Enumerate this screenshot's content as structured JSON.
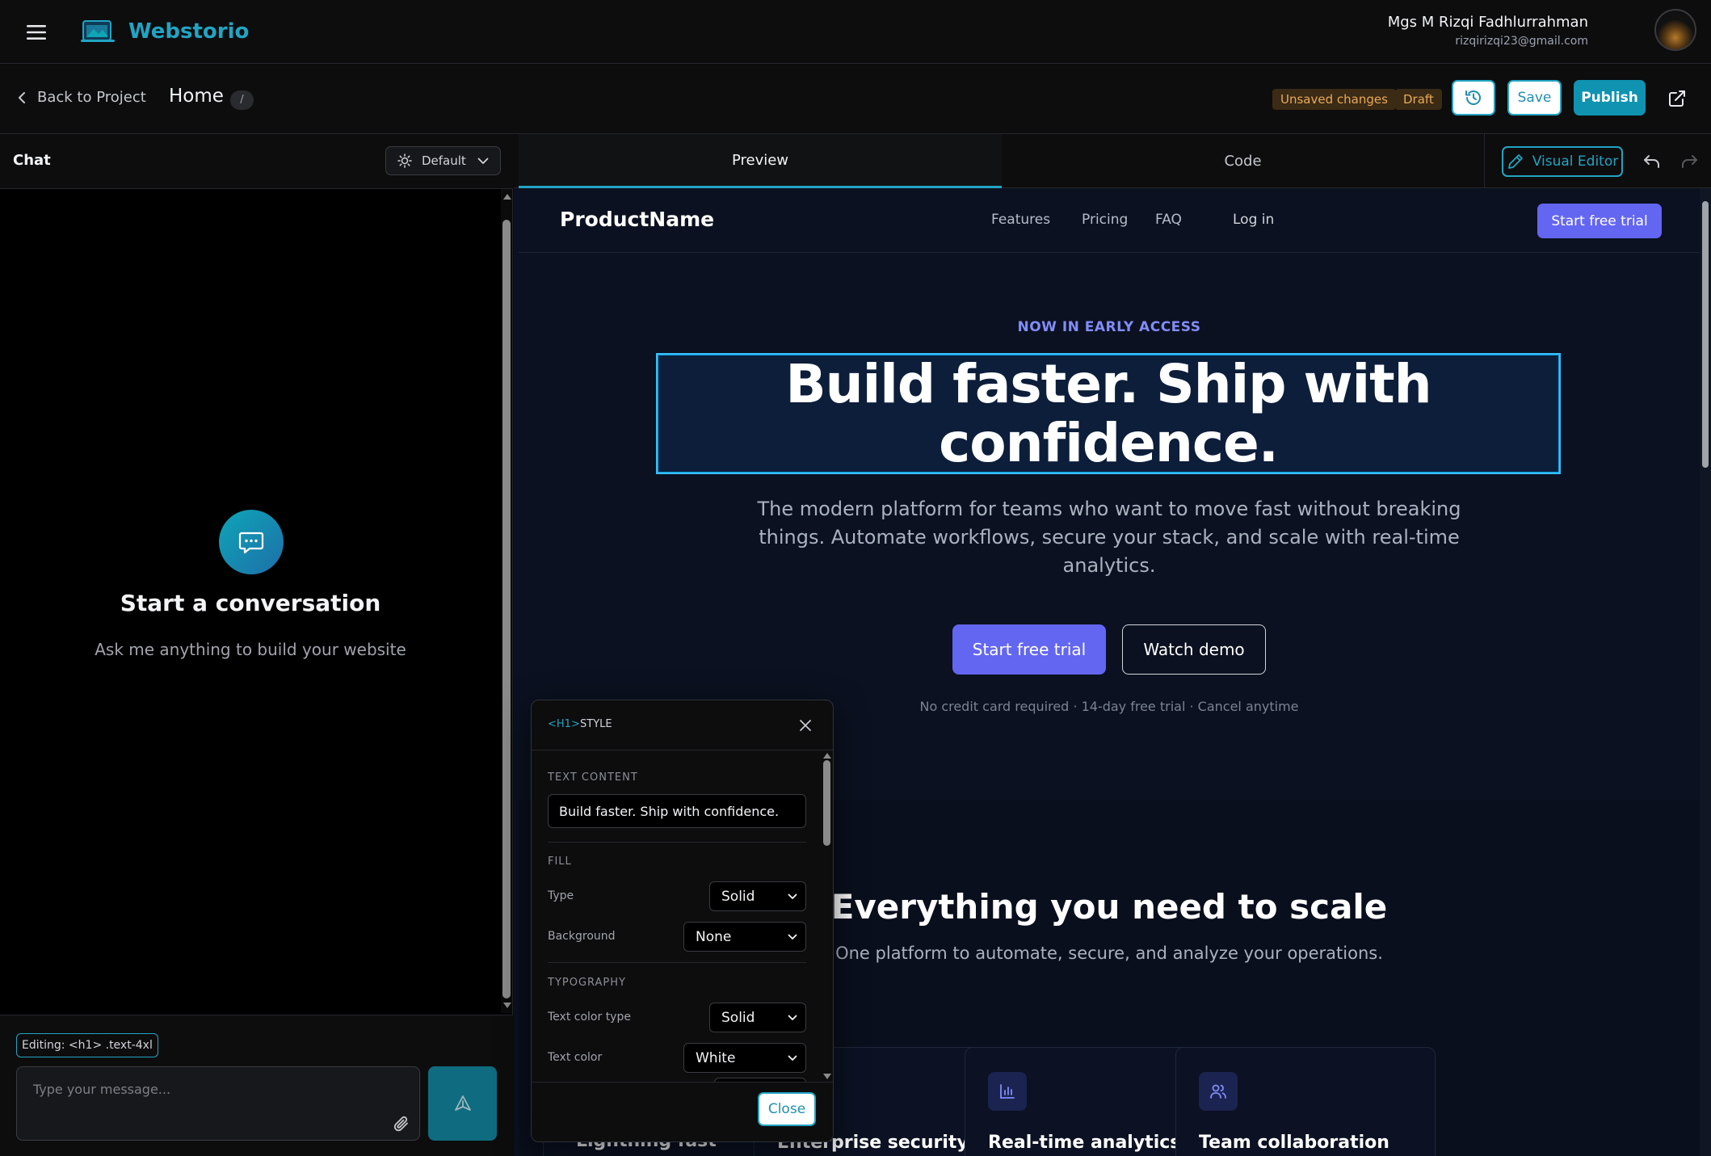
{
  "app": {
    "brand": "Webstorio",
    "user_name": "Mgs M Rizqi Fadhlurrahman",
    "user_email": "rizqirizqi23@gmail.com"
  },
  "header": {
    "back_label": "Back to Project",
    "page_title": "Home",
    "page_path": "/",
    "unsaved_badge": "Unsaved changes",
    "draft_badge": "Draft",
    "save_label": "Save",
    "publish_label": "Publish"
  },
  "chat": {
    "title": "Chat",
    "theme_value": "Default",
    "empty_title": "Start a conversation",
    "empty_subtitle": "Ask me anything to build your website",
    "editing_chip": "Editing: <h1> .text-4xl",
    "input_placeholder": "Type your message..."
  },
  "tabs": {
    "preview": "Preview",
    "code": "Code",
    "visual_editor": "Visual Editor"
  },
  "preview": {
    "nav": {
      "brand": "ProductName",
      "links": [
        "Features",
        "Pricing",
        "FAQ"
      ],
      "login": "Log in",
      "cta": "Start free trial"
    },
    "hero": {
      "eyebrow": "NOW IN EARLY ACCESS",
      "title": "Build faster. Ship with confidence.",
      "subtitle": "The modern platform for teams who want to move fast without breaking things. Automate workflows, secure your stack, and scale with real-time analytics.",
      "primary_cta": "Start free trial",
      "secondary_cta": "Watch demo",
      "fineprint": "No credit card required · 14-day free trial · Cancel anytime"
    },
    "features": {
      "title": "Everything you need to scale",
      "subtitle": "One platform to automate, secure, and analyze your operations.",
      "cards": [
        {
          "title": "Lightning fast",
          "icon": "bolt-icon"
        },
        {
          "title": "Enterprise security",
          "icon": "shield-icon"
        },
        {
          "title": "Real-time analytics",
          "icon": "bar-chart-icon"
        },
        {
          "title": "Team collaboration",
          "icon": "users-icon"
        }
      ]
    }
  },
  "style_panel": {
    "tag": "<H1>",
    "heading": "STYLE",
    "section_text": "TEXT CONTENT",
    "text_value": "Build faster. Ship with confidence.",
    "section_fill": "FILL",
    "type_label": "Type",
    "type_value": "Solid",
    "background_label": "Background",
    "background_value": "None",
    "section_typography": "TYPOGRAPHY",
    "text_color_type_label": "Text color type",
    "text_color_type_value": "Solid",
    "text_color_label": "Text color",
    "text_color_value": "White",
    "close_label": "Close"
  },
  "colors": {
    "accent": "#22a4c3",
    "indigo": "#6366f1",
    "warning": "#e8a95a"
  }
}
